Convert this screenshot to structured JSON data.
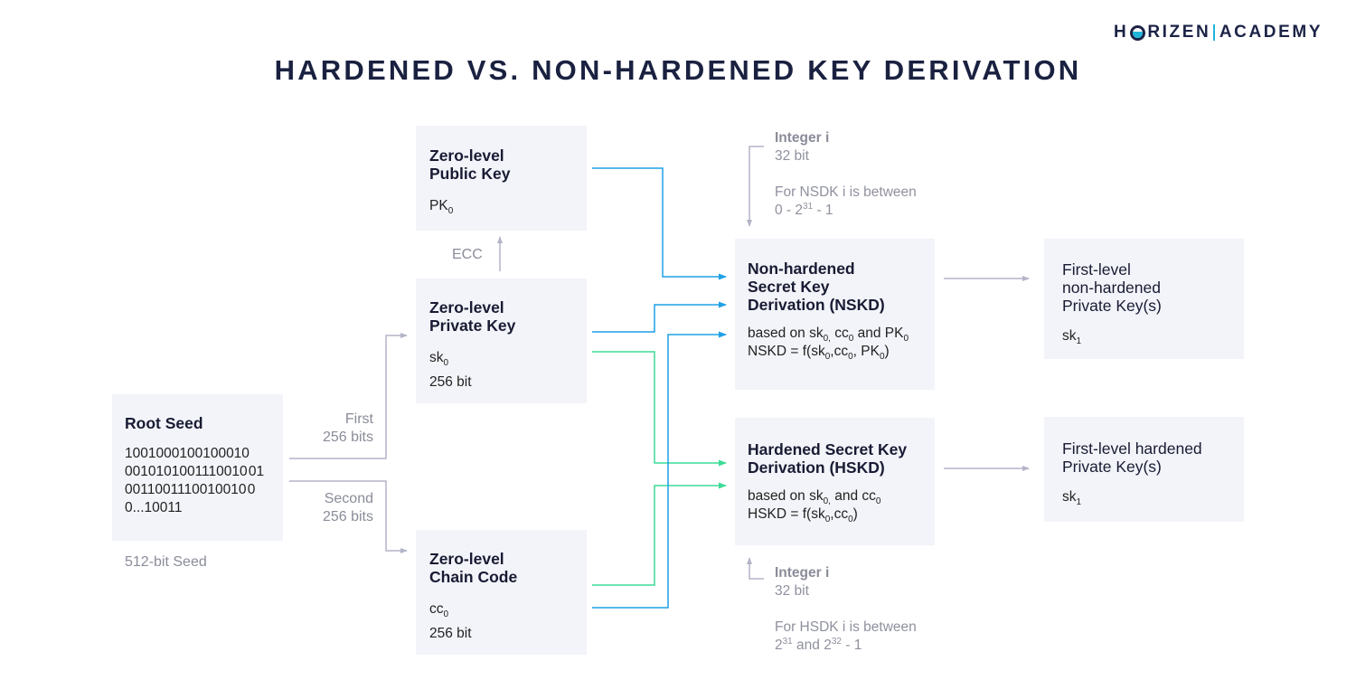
{
  "logo": {
    "part1": "H",
    "part2": "RIZEN",
    "part3": "ACADEMY"
  },
  "title": "HARDENED VS. NON-HARDENED KEY DERIVATION",
  "colors": {
    "blue": "#1ea0e6",
    "green": "#3ddc97",
    "gray_arrow": "#b3b4c8",
    "box_bg": "#f3f4f9",
    "title": "#1a2140"
  },
  "root_seed": {
    "heading": "Root Seed",
    "bits": [
      "1001000100100010",
      "0010101001110010 01",
      "0011001110010010 0",
      "0...10011"
    ],
    "caption": "512-bit Seed"
  },
  "split_labels": {
    "first": [
      "First",
      "256 bits"
    ],
    "second": [
      "Second",
      "256 bits"
    ]
  },
  "public_key": {
    "heading": [
      "Zero-level",
      "Public Key"
    ],
    "symbol": "PK",
    "symbol_sub": "0"
  },
  "ecc_label": "ECC",
  "private_key": {
    "heading": [
      "Zero-level",
      "Private Key"
    ],
    "symbol": "sk",
    "symbol_sub": "0",
    "size": "256 bit"
  },
  "chain_code": {
    "heading": [
      "Zero-level",
      "Chain Code"
    ],
    "symbol": "cc",
    "symbol_sub": "0",
    "size": "256 bit"
  },
  "nskd": {
    "heading": [
      "Non-hardened",
      "Secret Key",
      "Derivation (NSKD)"
    ],
    "based_on": {
      "prefix": "based on sk",
      "s1": "0,",
      "mid1": " cc",
      "s2": "0",
      "mid2": " and PK",
      "s3": "0"
    },
    "formula": {
      "prefix": "NSKD = f(sk",
      "s1": "0",
      "mid1": ",cc",
      "s2": "0",
      "mid2": ", PK",
      "s3": "0",
      "suffix": ")"
    }
  },
  "hskd": {
    "heading": [
      "Hardened Secret Key",
      "Derivation (HSKD)"
    ],
    "based_on": {
      "prefix": "based on sk",
      "s1": "0,",
      "mid1": " and cc",
      "s2": "0"
    },
    "formula": {
      "prefix": "HSKD = f(sk",
      "s1": "0",
      "mid1": ",cc",
      "s2": "0",
      "suffix": ")"
    }
  },
  "integer_top": {
    "title": "Integer i",
    "size": "32 bit",
    "range_line1": "For NSDK i is between",
    "range_line2": {
      "a": "0 - 2",
      "exp": "31",
      "b": " - 1"
    }
  },
  "integer_bottom": {
    "title": "Integer i",
    "size": "32 bit",
    "range_line1": "For HSDK i is between",
    "range_line2": {
      "a": "2",
      "exp1": "31",
      "b": " and 2",
      "exp2": "32",
      "c": " - 1"
    }
  },
  "first_level_nonhardened": {
    "heading": [
      "First-level",
      "non-hardened",
      "Private Key(s)"
    ],
    "symbol": "sk",
    "symbol_sub": "1"
  },
  "first_level_hardened": {
    "heading": [
      "First-level hardened",
      "Private Key(s)"
    ],
    "symbol": "sk",
    "symbol_sub": "1"
  }
}
